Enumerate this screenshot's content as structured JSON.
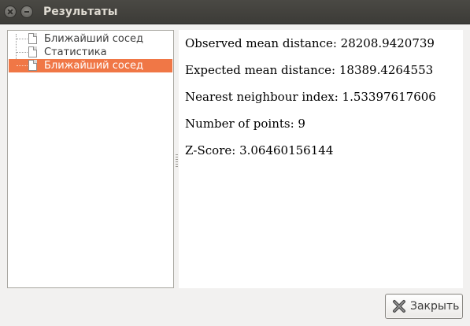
{
  "window": {
    "title": "Результаты"
  },
  "tree": {
    "items": [
      {
        "label": "Ближайший сосед"
      },
      {
        "label": "Статистика"
      },
      {
        "label": "Ближайший сосед"
      }
    ]
  },
  "results": {
    "lines": [
      "Observed mean distance: 28208.9420739",
      "Expected mean distance: 18389.4264553",
      "Nearest neighbour index: 1.53397617606",
      "Number of points: 9",
      "Z-Score: 3.06460156144"
    ]
  },
  "buttons": {
    "close_label": "Закрыть"
  },
  "colors": {
    "selection": "#f07746",
    "titlebar": "#3c3b37"
  }
}
